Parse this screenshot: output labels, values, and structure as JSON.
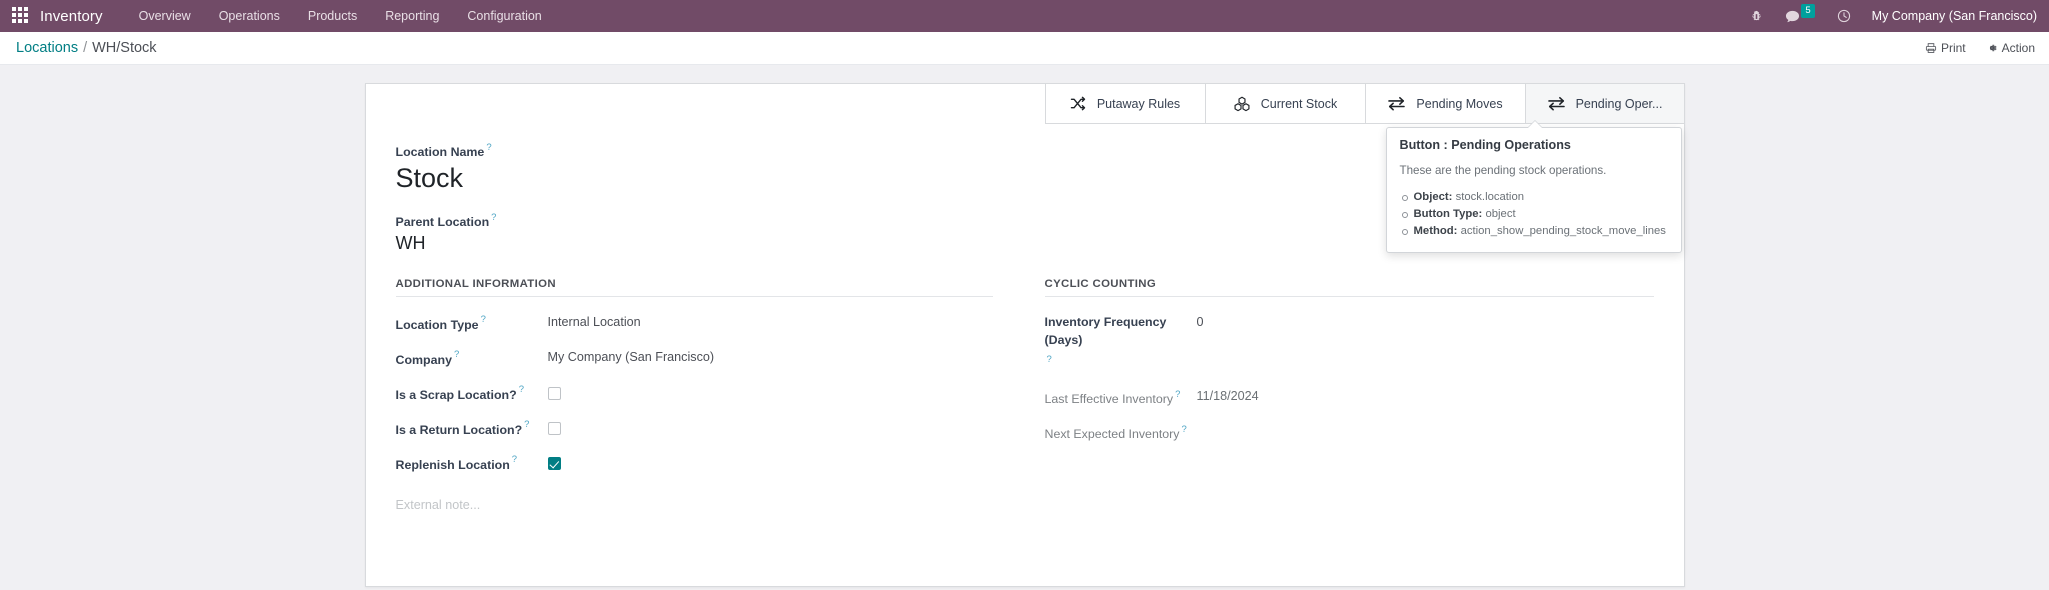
{
  "navbar": {
    "apps_icon": "apps-grid-icon",
    "brand": "Inventory",
    "menu": [
      {
        "label": "Overview"
      },
      {
        "label": "Operations"
      },
      {
        "label": "Products"
      },
      {
        "label": "Reporting"
      },
      {
        "label": "Configuration"
      }
    ],
    "systray": {
      "debug_icon": "bug-icon",
      "messaging_icon": "chat-bubble-icon",
      "messaging_count": "5",
      "activity_icon": "clock-icon",
      "company": "My Company (San Francisco)"
    },
    "bg_color": "#714B67",
    "badge_color": "#00a09d"
  },
  "control_panel": {
    "breadcrumb": {
      "parent": "Locations",
      "separator": "/",
      "current": "WH/Stock"
    },
    "print_label": "Print",
    "action_label": "Action",
    "print_icon": "printer-icon",
    "action_icon": "gear-icon"
  },
  "stat_buttons": [
    {
      "label": "Putaway Rules",
      "icon": "shuffle-icon",
      "active": false
    },
    {
      "label": "Current Stock",
      "icon": "cubes-icon",
      "active": false
    },
    {
      "label": "Pending Moves",
      "icon": "exchange-icon",
      "active": false
    },
    {
      "label": "Pending Oper...",
      "icon": "exchange-icon",
      "active": true
    }
  ],
  "form": {
    "location_name_label": "Location Name",
    "location_name_value": "Stock",
    "parent_location_label": "Parent Location",
    "parent_location_value": "WH",
    "help_marker": "?",
    "note_placeholder": "External note...",
    "groups": {
      "additional_information": {
        "title": "ADDITIONAL INFORMATION",
        "rows": [
          {
            "label": "Location Type",
            "value": "Internal Location",
            "type": "text"
          },
          {
            "label": "Company",
            "value": "My Company (San Francisco)",
            "type": "text"
          },
          {
            "label": "Is a Scrap Location?",
            "value": "",
            "type": "checkbox",
            "checked": false
          },
          {
            "label": "Is a Return Location?",
            "value": "",
            "type": "checkbox",
            "checked": false
          },
          {
            "label": "Replenish Location",
            "value": "",
            "type": "checkbox",
            "checked": true
          }
        ]
      },
      "cyclic_counting": {
        "title": "CYCLIC COUNTING",
        "rows": [
          {
            "label": "Inventory Frequency (Days)",
            "value": "0",
            "type": "text",
            "muted": false
          },
          {
            "label": "Last Effective Inventory",
            "value": "11/18/2024",
            "type": "date",
            "muted": true
          },
          {
            "label": "Next Expected Inventory",
            "value": "",
            "type": "date",
            "muted": true
          }
        ]
      }
    }
  },
  "tooltip": {
    "title": "Button : Pending Operations",
    "description": "These are the pending stock operations.",
    "items": [
      {
        "key": "Object:",
        "value": "stock.location"
      },
      {
        "key": "Button Type:",
        "value": "object"
      },
      {
        "key": "Method:",
        "value": "action_show_pending_stock_move_lines"
      }
    ]
  },
  "theme": {
    "accent": "#017e84",
    "link": "#017e84",
    "page_bg": "#f0f0f3"
  }
}
